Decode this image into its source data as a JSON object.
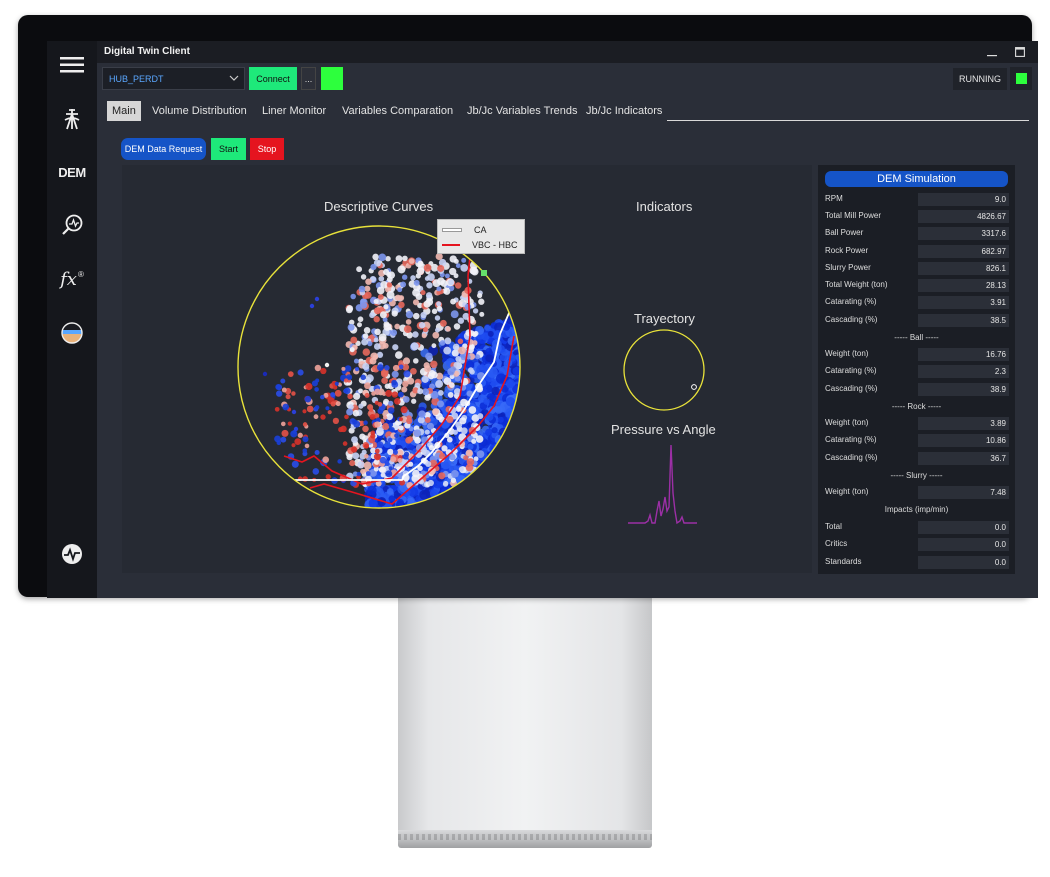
{
  "window": {
    "title": "Digital Twin Client"
  },
  "sidebar": {
    "items": [
      {
        "icon": "menu-icon"
      },
      {
        "icon": "mill-tower-icon"
      },
      {
        "icon": "dem-icon",
        "label": "DEM"
      },
      {
        "icon": "search-chart-icon"
      },
      {
        "icon": "function-icon",
        "label": "fx"
      },
      {
        "icon": "layers-icon"
      },
      {
        "icon": "signal-icon"
      }
    ]
  },
  "toolbar": {
    "hub_value": "HUB_PERDT",
    "connect_label": "Connect",
    "more_label": "...",
    "status_label": "RUNNING",
    "status_color": "#2dff3d"
  },
  "tabs": [
    {
      "label": "Main",
      "active": true
    },
    {
      "label": "Volume Distribution"
    },
    {
      "label": "Liner Monitor"
    },
    {
      "label": "Variables Comparation"
    },
    {
      "label": "Jb/Jc Variables Trends"
    },
    {
      "label": "Jb/Jc Indicators"
    }
  ],
  "actions": {
    "dem_request_label": "DEM Data Request",
    "start_label": "Start",
    "stop_label": "Stop"
  },
  "plots": {
    "descriptive_title": "Descriptive Curves",
    "indicators_title": "Indicators",
    "trajectory_title": "Trayectory",
    "pressure_title": "Pressure vs Angle",
    "legend": [
      {
        "label": "CA",
        "color": "#ffffff"
      },
      {
        "label": "VBC - HBC",
        "color": "#e5141f"
      }
    ]
  },
  "dem": {
    "title": "DEM Simulation",
    "general": [
      {
        "label": "RPM",
        "value": "9.0"
      },
      {
        "label": "Total Mill Power",
        "value": "4826.67"
      },
      {
        "label": "Ball Power",
        "value": "3317.6"
      },
      {
        "label": "Rock Power",
        "value": "682.97"
      },
      {
        "label": "Slurry Power",
        "value": "826.1"
      },
      {
        "label": "Total Weight (ton)",
        "value": "28.13"
      },
      {
        "label": "Catarating (%)",
        "value": "3.91"
      },
      {
        "label": "Cascading (%)",
        "value": "38.5"
      }
    ],
    "ball_header": "----- Ball -----",
    "ball": [
      {
        "label": "Weight (ton)",
        "value": "16.76"
      },
      {
        "label": "Catarating (%)",
        "value": "2.3"
      },
      {
        "label": "Cascading (%)",
        "value": "38.9"
      }
    ],
    "rock_header": "----- Rock -----",
    "rock": [
      {
        "label": "Weight (ton)",
        "value": "3.89"
      },
      {
        "label": "Catarating (%)",
        "value": "10.86"
      },
      {
        "label": "Cascading (%)",
        "value": "36.7"
      }
    ],
    "slurry_header": "----- Slurry -----",
    "slurry": [
      {
        "label": "Weight (ton)",
        "value": "7.48"
      }
    ],
    "impacts_header": "Impacts (imp/min)",
    "impacts": [
      {
        "label": "Total",
        "value": "0.0"
      },
      {
        "label": "Critics",
        "value": "0.0"
      },
      {
        "label": "Standards",
        "value": "0.0"
      }
    ]
  }
}
